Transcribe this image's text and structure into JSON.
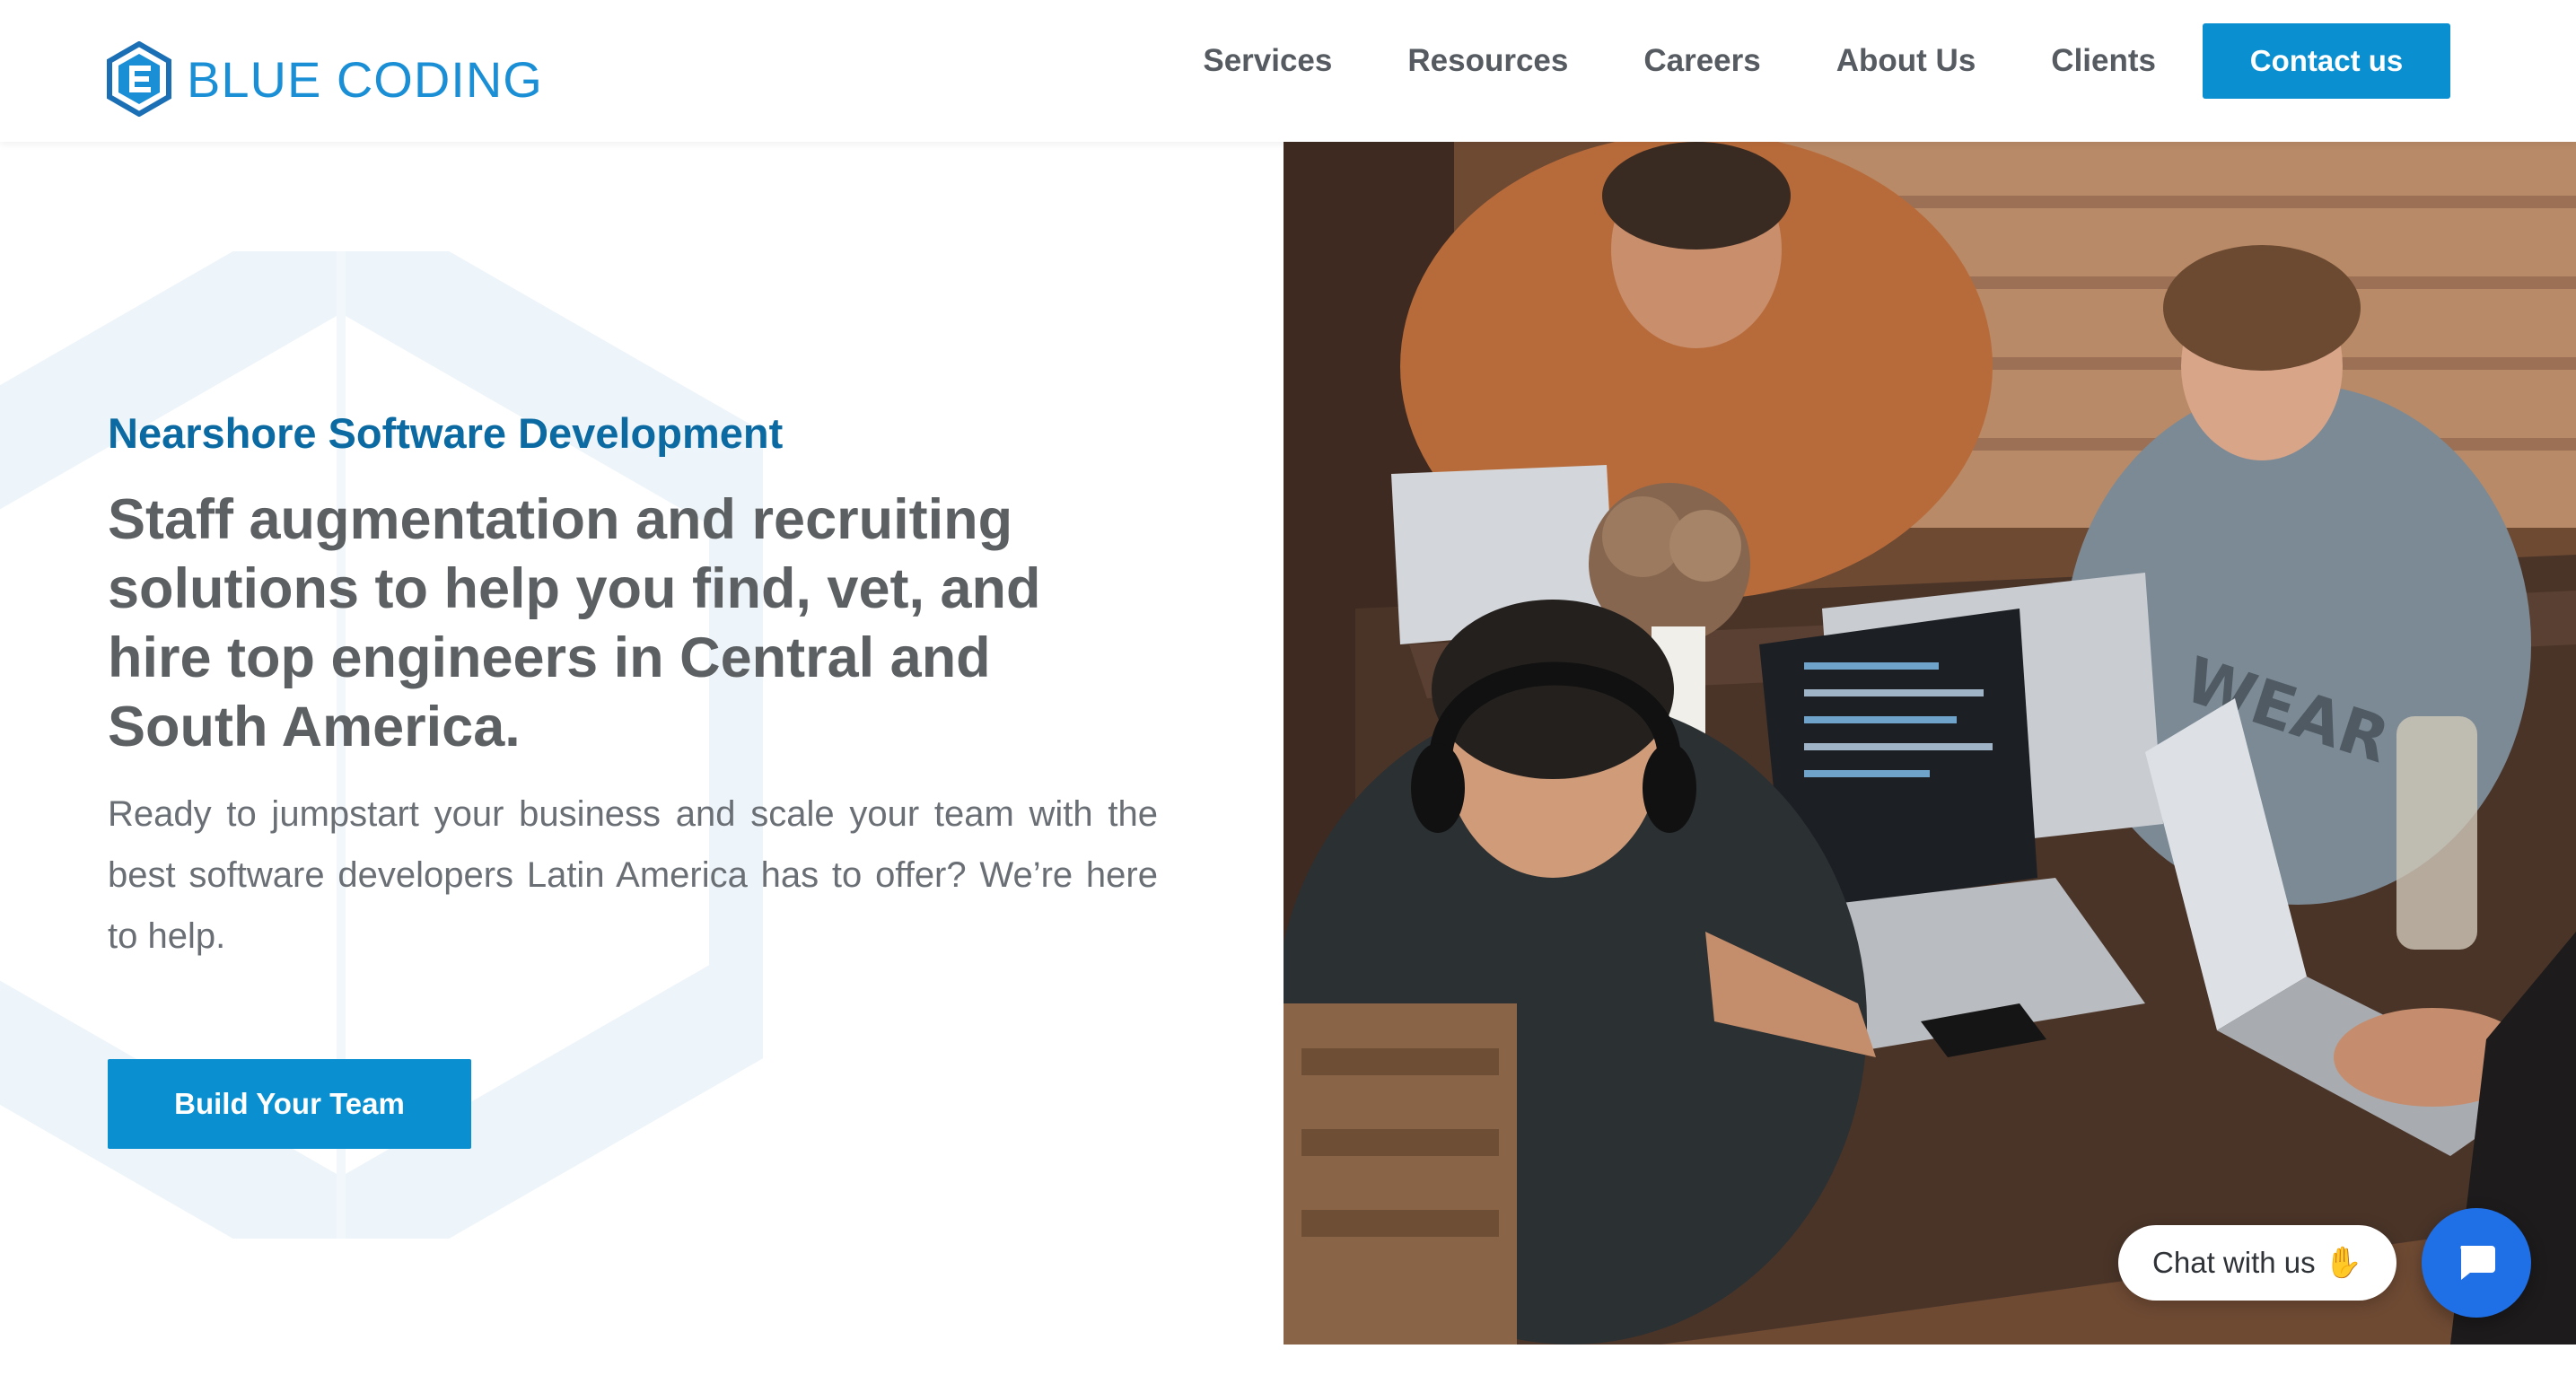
{
  "header": {
    "logo_text": "BLUE CODING",
    "nav": [
      "Services",
      "Resources",
      "Careers",
      "About Us",
      "Clients"
    ],
    "contact_button": "Contact us"
  },
  "hero": {
    "eyebrow": "Nearshore Software Development",
    "headline": "Staff augmentation and recruiting solutions to help you find, vet, and hire top engineers in Central and South America.",
    "body": "Ready to jumpstart your business and scale your team with the best software developers Latin America has to offer? We’re here to help.",
    "cta": "Build Your Team",
    "photo_icon": "team-working-photo"
  },
  "chat": {
    "bubble_text": "Chat with us",
    "wave_icon": "waving-hand-icon",
    "launcher_icon": "chat-bubble-icon"
  },
  "colors": {
    "brand_blue": "#0a8fd1",
    "eyebrow_blue": "#0b6aa2",
    "logo_blue": "#1a8fd6",
    "text_gray": "#5d6063",
    "chat_blue": "#1f6fe6"
  }
}
